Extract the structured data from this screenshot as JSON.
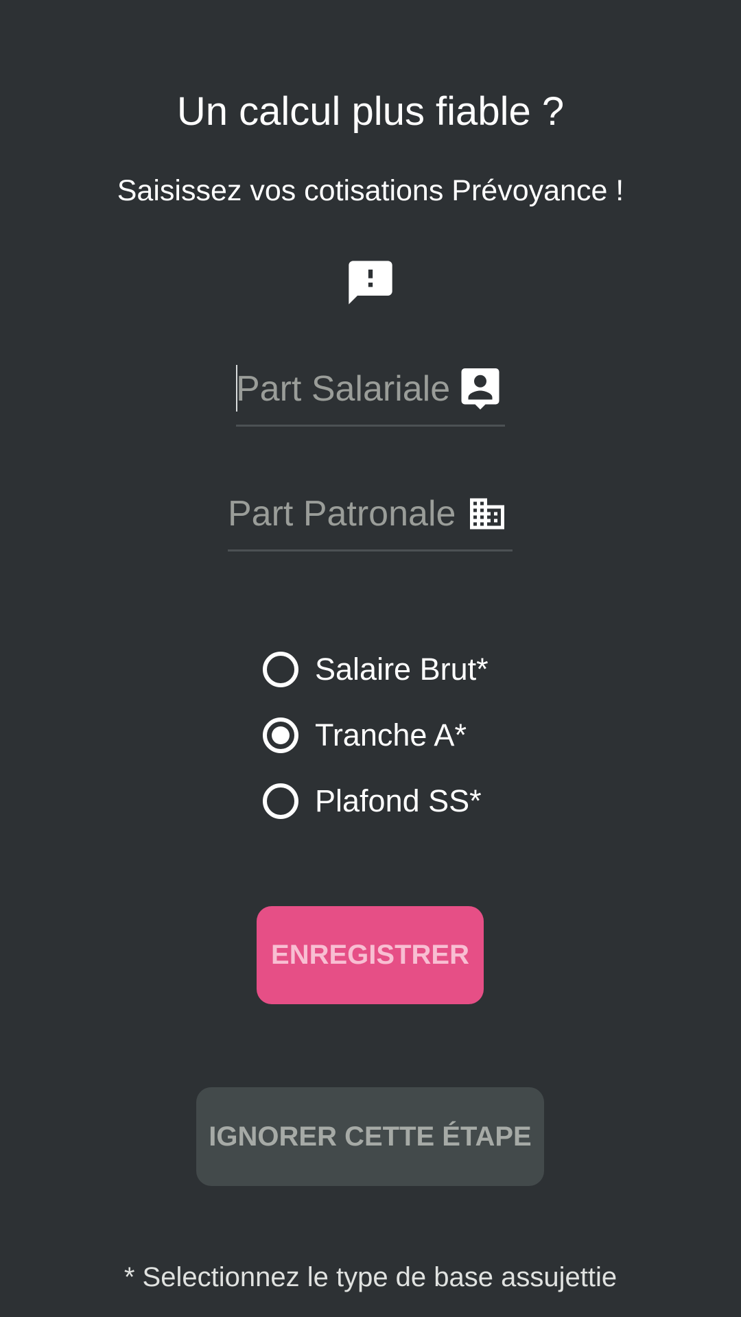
{
  "header": {
    "title": "Un calcul plus fiable ?",
    "subtitle": "Saisissez vos cotisations Prévoyance !",
    "alert_icon": "feedback-alert-icon"
  },
  "form": {
    "salariale": {
      "placeholder": "Part Salariale",
      "value": "",
      "icon": "contact-card-icon"
    },
    "patronale": {
      "placeholder": "Part Patronale",
      "value": "",
      "icon": "business-building-icon"
    },
    "base_options": [
      {
        "label": "Salaire Brut*",
        "checked": false
      },
      {
        "label": "Tranche A*",
        "checked": true
      },
      {
        "label": "Plafond SS*",
        "checked": false
      }
    ]
  },
  "actions": {
    "save_label": "ENREGISTRER",
    "skip_label": "IGNORER CETTE ÉTAPE"
  },
  "footnote": "* Selectionnez le type de base assujettie",
  "colors": {
    "background": "#2d3134",
    "accent": "#e64f86",
    "secondary_button": "#434a4b"
  }
}
